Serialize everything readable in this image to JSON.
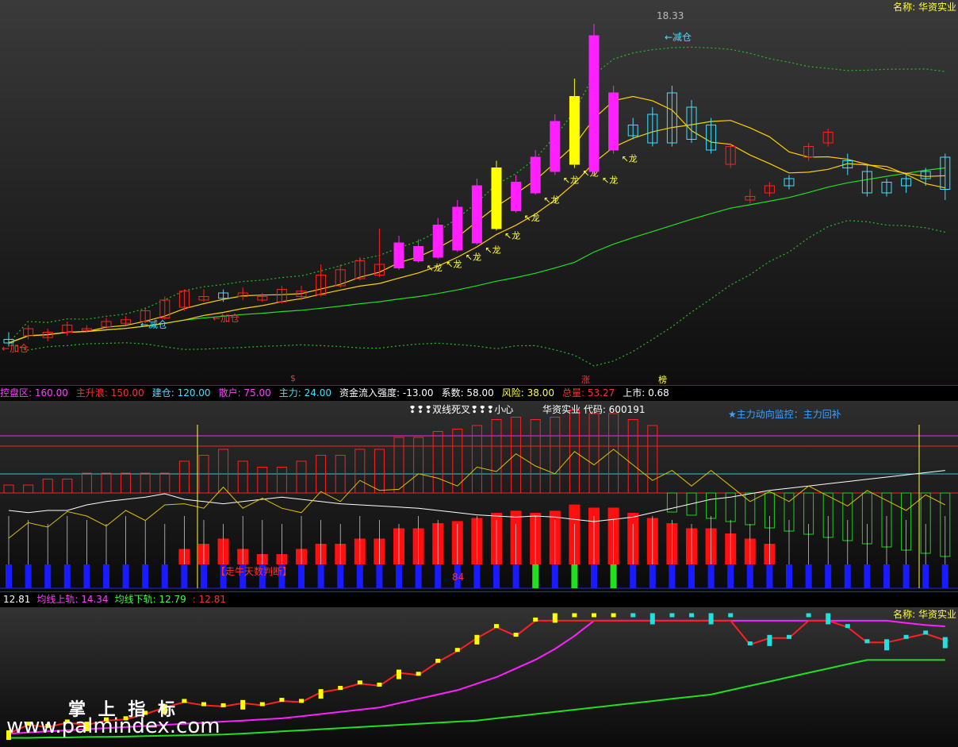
{
  "panel1": {
    "name_label": "名称: 华资实业",
    "high_label": "18.33",
    "jiancang1": "←减仓",
    "jiancang2": "←减仓",
    "jiacang1": "←加仓",
    "jiacang2": "←加仓",
    "long_label": "龙",
    "zhang": "涨",
    "bang": "榜",
    "dollar": "$"
  },
  "info1": [
    {
      "text": "控盘区: 160.00",
      "color": "#ff40ff"
    },
    {
      "text": "主升浪: 150.00",
      "color": "#ff3030"
    },
    {
      "text": "建仓: 120.00",
      "color": "#40e0ff"
    },
    {
      "text": "散户: 75.00",
      "color": "#ff40ff"
    },
    {
      "text": "主力: 24.00",
      "color": "#40e0ff"
    },
    {
      "text": "资金流入强度: -13.00",
      "color": "#ffffff"
    },
    {
      "text": "系数: 58.00",
      "color": "#ffffff"
    },
    {
      "text": "风险: 38.00",
      "color": "#ffff40"
    },
    {
      "text": "总量: 53.27",
      "color": "#ff3030"
    },
    {
      "text": "上市: 0.68",
      "color": "#ffffff"
    }
  ],
  "panel2": {
    "title": "❢❢❢双线死叉❢❢❢小心",
    "code_label": "华资实业 代码: 600191",
    "monitor": "★主力动向监控：主力回补",
    "walk_label": "【走牛天数判断】",
    "days_value": "84"
  },
  "info2": [
    {
      "text": "12.81",
      "color": "#ffffff"
    },
    {
      "text": "均线上轨: 14.34",
      "color": "#ff40ff"
    },
    {
      "text": "均线下轨: 12.79",
      "color": "#40ff40"
    },
    {
      "text": ": 12.81",
      "color": "#ff3030"
    }
  ],
  "panel3": {
    "name_label": "名称: 华资实业"
  },
  "watermark": {
    "cn": "掌 上 指 标",
    "url": "www.palmindex.com"
  },
  "colors": {
    "up": "#ff2020",
    "down": "#40e0ff",
    "magenta": "#ff20ff",
    "yellow": "#ffff00",
    "ma_fast": "#ffd000",
    "ma_slow": "#20e020",
    "band": "#20c020"
  },
  "chart_data": [
    {
      "type": "candlestick",
      "title": "华资实业",
      "x": [
        1,
        2,
        3,
        4,
        5,
        6,
        7,
        8,
        9,
        10,
        11,
        12,
        13,
        14,
        15,
        16,
        17,
        18,
        19,
        20,
        21,
        22,
        23,
        24,
        25,
        26,
        27,
        28,
        29,
        30,
        31,
        32,
        33,
        34,
        35,
        36,
        37,
        38,
        39,
        40,
        41,
        42,
        43,
        44,
        45,
        46,
        47,
        48,
        49
      ],
      "open": [
        9.5,
        9.6,
        9.55,
        9.7,
        9.75,
        9.85,
        9.95,
        10.0,
        10.1,
        10.4,
        10.6,
        10.8,
        10.7,
        10.6,
        10.55,
        10.7,
        10.75,
        11.0,
        11.2,
        11.3,
        11.5,
        11.7,
        11.8,
        12.0,
        12.2,
        12.6,
        13.1,
        13.6,
        14.2,
        14.4,
        14.2,
        14.8,
        15.5,
        15.8,
        16.4,
        16.0,
        15.5,
        14.4,
        13.4,
        13.6,
        14.0,
        14.6,
        15.0,
        14.5,
        14.2,
        13.9,
        14.0,
        14.2,
        14.6
      ],
      "close": [
        9.4,
        9.8,
        9.7,
        9.9,
        9.8,
        10.0,
        10.05,
        10.3,
        10.6,
        10.85,
        10.7,
        10.65,
        10.8,
        10.7,
        10.9,
        10.85,
        11.3,
        11.45,
        11.7,
        11.6,
        12.2,
        12.1,
        12.7,
        13.2,
        13.8,
        14.3,
        13.9,
        14.6,
        15.6,
        16.3,
        18.0,
        16.4,
        15.2,
        15.0,
        15.0,
        15.1,
        14.8,
        14.9,
        13.5,
        13.8,
        13.8,
        14.9,
        15.3,
        14.3,
        13.6,
        13.6,
        13.8,
        14.0,
        13.7
      ],
      "high": [
        9.7,
        9.9,
        9.8,
        10.0,
        9.9,
        10.1,
        10.15,
        10.4,
        10.7,
        10.9,
        10.9,
        10.9,
        10.95,
        10.8,
        11.0,
        11.0,
        11.6,
        11.6,
        11.8,
        12.6,
        12.4,
        12.3,
        12.9,
        13.4,
        14.0,
        14.5,
        14.1,
        14.8,
        15.8,
        16.8,
        18.33,
        16.6,
        15.7,
        16.0,
        16.6,
        16.2,
        15.7,
        15.0,
        13.7,
        13.9,
        14.1,
        15.0,
        15.4,
        14.7,
        14.4,
        14.0,
        14.1,
        14.3,
        14.7
      ],
      "low": [
        9.3,
        9.5,
        9.45,
        9.6,
        9.7,
        9.8,
        9.9,
        9.95,
        10.05,
        10.3,
        10.55,
        10.55,
        10.6,
        10.55,
        10.5,
        10.6,
        10.7,
        10.95,
        11.15,
        11.25,
        11.45,
        11.65,
        11.75,
        11.95,
        12.15,
        12.55,
        13.05,
        13.55,
        14.1,
        14.3,
        14.1,
        14.7,
        15.1,
        14.9,
        14.9,
        15.0,
        14.7,
        14.3,
        13.3,
        13.5,
        13.7,
        14.5,
        14.9,
        14.1,
        13.5,
        13.5,
        13.6,
        13.8,
        13.4
      ]
    },
    {
      "type": "bar",
      "title": "❢❢❢双线死叉❢❢❢小心",
      "x": [
        1,
        2,
        3,
        4,
        5,
        6,
        7,
        8,
        9,
        10,
        11,
        12,
        13,
        14,
        15,
        16,
        17,
        18,
        19,
        20,
        21,
        22,
        23,
        24,
        25,
        26,
        27,
        28,
        29,
        30,
        31,
        32,
        33,
        34,
        35,
        36,
        37,
        38,
        39,
        40,
        41,
        42,
        43,
        44,
        45,
        46,
        47,
        48,
        49
      ],
      "series": [
        {
          "name": "主力",
          "values": [
            15,
            15,
            20,
            20,
            25,
            25,
            25,
            25,
            25,
            35,
            40,
            45,
            35,
            30,
            30,
            35,
            40,
            40,
            45,
            45,
            55,
            55,
            60,
            62,
            65,
            70,
            72,
            70,
            72,
            78,
            75,
            75,
            70,
            65,
            60,
            55,
            55,
            50,
            45,
            40,
            40,
            40,
            40,
            40,
            40,
            40,
            40,
            40,
            40
          ]
        },
        {
          "name": "散户",
          "values": [
            30,
            28,
            30,
            30,
            35,
            38,
            40,
            42,
            45,
            40,
            38,
            36,
            38,
            40,
            42,
            40,
            38,
            36,
            35,
            34,
            33,
            32,
            30,
            28,
            26,
            25,
            24,
            25,
            24,
            22,
            20,
            22,
            24,
            28,
            32,
            36,
            40,
            42,
            45,
            48,
            50,
            52,
            54,
            56,
            58,
            60,
            62,
            64,
            66
          ]
        }
      ]
    },
    {
      "type": "line",
      "title": "华资实业",
      "x": [
        1,
        2,
        3,
        4,
        5,
        6,
        7,
        8,
        9,
        10,
        11,
        12,
        13,
        14,
        15,
        16,
        17,
        18,
        19,
        20,
        21,
        22,
        23,
        24,
        25,
        26,
        27,
        28,
        29,
        30,
        31,
        32,
        33,
        34,
        35,
        36,
        37,
        38,
        39,
        40,
        41,
        42,
        43,
        44,
        45,
        46,
        47,
        48,
        49
      ],
      "series": [
        {
          "name": "均线上轨",
          "values": [
            9.4,
            9.45,
            9.5,
            9.55,
            9.6,
            9.65,
            9.7,
            9.75,
            9.8,
            9.85,
            9.9,
            9.95,
            10.0,
            10.05,
            10.1,
            10.2,
            10.3,
            10.4,
            10.5,
            10.6,
            10.8,
            11.0,
            11.2,
            11.4,
            11.7,
            12.0,
            12.4,
            12.8,
            13.3,
            13.9,
            14.6,
            14.6,
            14.6,
            14.6,
            14.6,
            14.6,
            14.6,
            14.6,
            14.6,
            14.6,
            14.6,
            14.6,
            14.6,
            14.6,
            14.6,
            14.6,
            14.5,
            14.4,
            14.34
          ]
        },
        {
          "name": "均线下轨",
          "values": [
            9.2,
            9.2,
            9.22,
            9.22,
            9.24,
            9.25,
            9.26,
            9.28,
            9.3,
            9.32,
            9.34,
            9.36,
            9.4,
            9.45,
            9.5,
            9.55,
            9.6,
            9.65,
            9.7,
            9.75,
            9.8,
            9.85,
            9.9,
            9.95,
            10.0,
            10.1,
            10.2,
            10.3,
            10.4,
            10.5,
            10.6,
            10.7,
            10.8,
            10.9,
            11.0,
            11.1,
            11.2,
            11.4,
            11.6,
            11.8,
            12.0,
            12.2,
            12.4,
            12.6,
            12.79,
            12.79,
            12.79,
            12.79,
            12.79
          ]
        }
      ]
    }
  ]
}
